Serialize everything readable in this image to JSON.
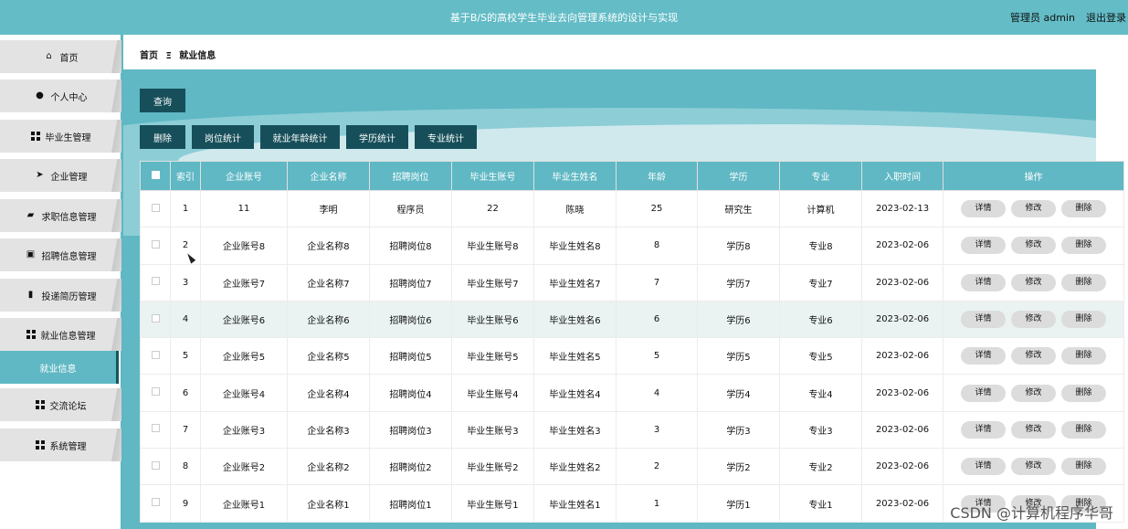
{
  "header": {
    "title": "基于B/S的高校学生毕业去向管理系统的设计与实现",
    "user": "管理员 admin",
    "logout": "退出登录"
  },
  "sidebar": {
    "items": [
      {
        "label": "首页",
        "icon": "home-icon"
      },
      {
        "label": "个人中心",
        "icon": "user-icon"
      },
      {
        "label": "毕业生管理",
        "icon": "grid-icon"
      },
      {
        "label": "企业管理",
        "icon": "send-icon"
      },
      {
        "label": "求职信息管理",
        "icon": "thumb-icon"
      },
      {
        "label": "招聘信息管理",
        "icon": "briefcase-icon"
      },
      {
        "label": "投递简历管理",
        "icon": "bar-chart-icon"
      },
      {
        "label": "就业信息管理",
        "icon": "grid-icon"
      },
      {
        "label": "就业信息",
        "icon": ""
      },
      {
        "label": "交流论坛",
        "icon": "grid-icon"
      },
      {
        "label": "系统管理",
        "icon": "grid-icon"
      }
    ],
    "active_index": 8
  },
  "breadcrumb": {
    "home": "首页",
    "separator": "Ξ",
    "current": "就业信息"
  },
  "toolbar": {
    "query": "查询",
    "delete": "删除",
    "stat_position": "岗位统计",
    "stat_age": "就业年龄统计",
    "stat_education": "学历统计",
    "stat_major": "专业统计"
  },
  "table": {
    "headers": [
      "索引",
      "企业账号",
      "企业名称",
      "招聘岗位",
      "毕业生账号",
      "毕业生姓名",
      "年龄",
      "学历",
      "专业",
      "入职时间",
      "操作"
    ],
    "actions": {
      "detail": "详情",
      "edit": "修改",
      "delete": "删除"
    },
    "rows": [
      [
        "1",
        "11",
        "李明",
        "程序员",
        "22",
        "陈晓",
        "25",
        "研究生",
        "计算机",
        "2023-02-13"
      ],
      [
        "2",
        "企业账号8",
        "企业名称8",
        "招聘岗位8",
        "毕业生账号8",
        "毕业生姓名8",
        "8",
        "学历8",
        "专业8",
        "2023-02-06"
      ],
      [
        "3",
        "企业账号7",
        "企业名称7",
        "招聘岗位7",
        "毕业生账号7",
        "毕业生姓名7",
        "7",
        "学历7",
        "专业7",
        "2023-02-06"
      ],
      [
        "4",
        "企业账号6",
        "企业名称6",
        "招聘岗位6",
        "毕业生账号6",
        "毕业生姓名6",
        "6",
        "学历6",
        "专业6",
        "2023-02-06"
      ],
      [
        "5",
        "企业账号5",
        "企业名称5",
        "招聘岗位5",
        "毕业生账号5",
        "毕业生姓名5",
        "5",
        "学历5",
        "专业5",
        "2023-02-06"
      ],
      [
        "6",
        "企业账号4",
        "企业名称4",
        "招聘岗位4",
        "毕业生账号4",
        "毕业生姓名4",
        "4",
        "学历4",
        "专业4",
        "2023-02-06"
      ],
      [
        "7",
        "企业账号3",
        "企业名称3",
        "招聘岗位3",
        "毕业生账号3",
        "毕业生姓名3",
        "3",
        "学历3",
        "专业3",
        "2023-02-06"
      ],
      [
        "8",
        "企业账号2",
        "企业名称2",
        "招聘岗位2",
        "毕业生账号2",
        "毕业生姓名2",
        "2",
        "学历2",
        "专业2",
        "2023-02-06"
      ],
      [
        "9",
        "企业账号1",
        "企业名称1",
        "招聘岗位1",
        "毕业生账号1",
        "毕业生姓名1",
        "1",
        "学历1",
        "专业1",
        "2023-02-06"
      ]
    ],
    "highlight_row": 3
  },
  "watermark": "CSDN @计算机程序华哥",
  "colors": {
    "accent": "#5fb8c4",
    "button_dark": "#164f5a",
    "nav_bg": "#e3e3e3"
  }
}
